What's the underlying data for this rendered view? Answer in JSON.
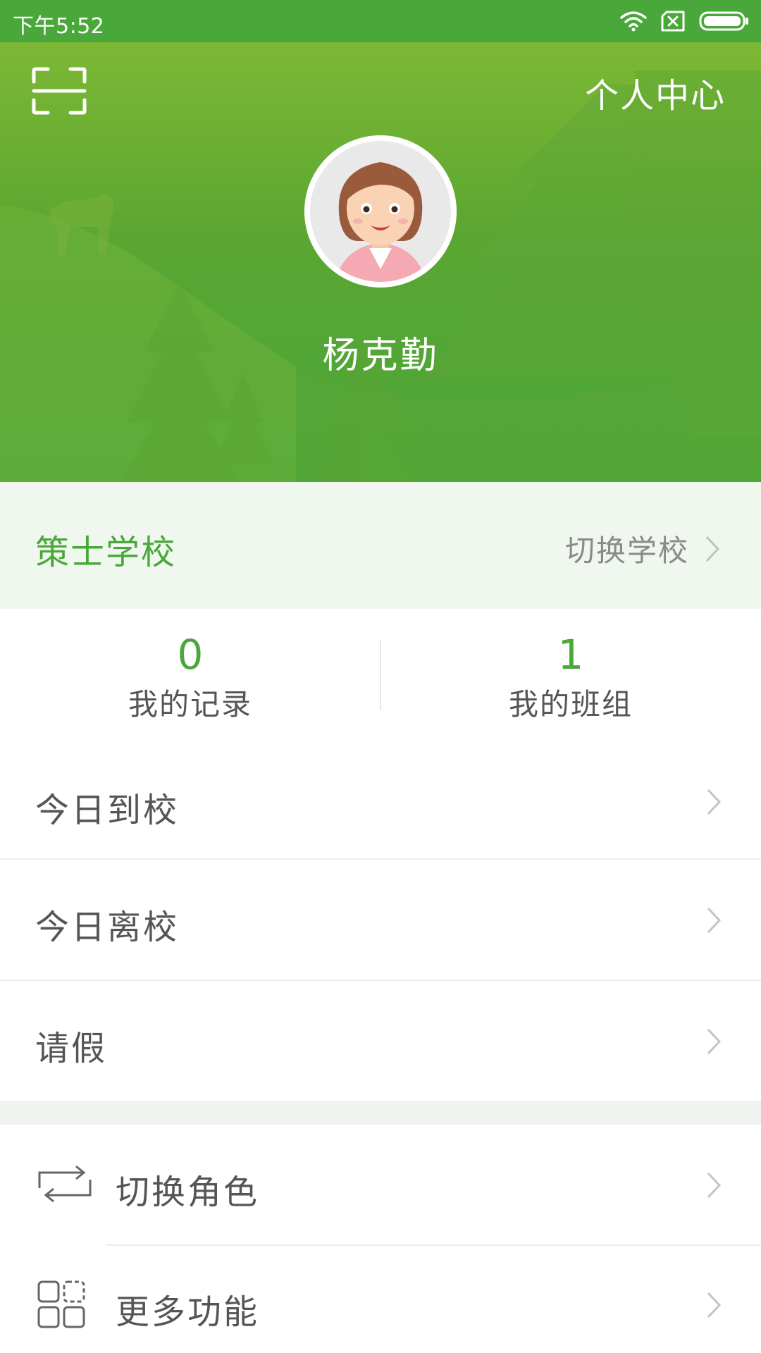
{
  "status_bar": {
    "time": "下午5:52",
    "icons": [
      "wifi-icon",
      "sim-card-x-icon",
      "battery-icon"
    ]
  },
  "header": {
    "title": "个人中心",
    "scan_icon": "scan-icon"
  },
  "profile": {
    "avatar_icon": "cartoon-woman-avatar",
    "name": "杨克勤"
  },
  "school": {
    "name": "策士学校",
    "switch_label": "切换学校"
  },
  "stats": [
    {
      "value": "0",
      "label": "我的记录"
    },
    {
      "value": "1",
      "label": "我的班组"
    }
  ],
  "menu": [
    {
      "label": "今日到校"
    },
    {
      "label": "今日离校"
    },
    {
      "label": "请假"
    }
  ],
  "menu2": [
    {
      "label": "切换角色",
      "icon": "swap-arrows-icon"
    },
    {
      "label": "更多功能",
      "icon": "grid-apps-icon"
    }
  ],
  "colors": {
    "brand_green": "#4aa83a",
    "header_green_light": "#7db834",
    "school_bar_bg": "#eff7ef",
    "text_gray": "#555555",
    "chevron_gray": "#bdbdbd"
  }
}
